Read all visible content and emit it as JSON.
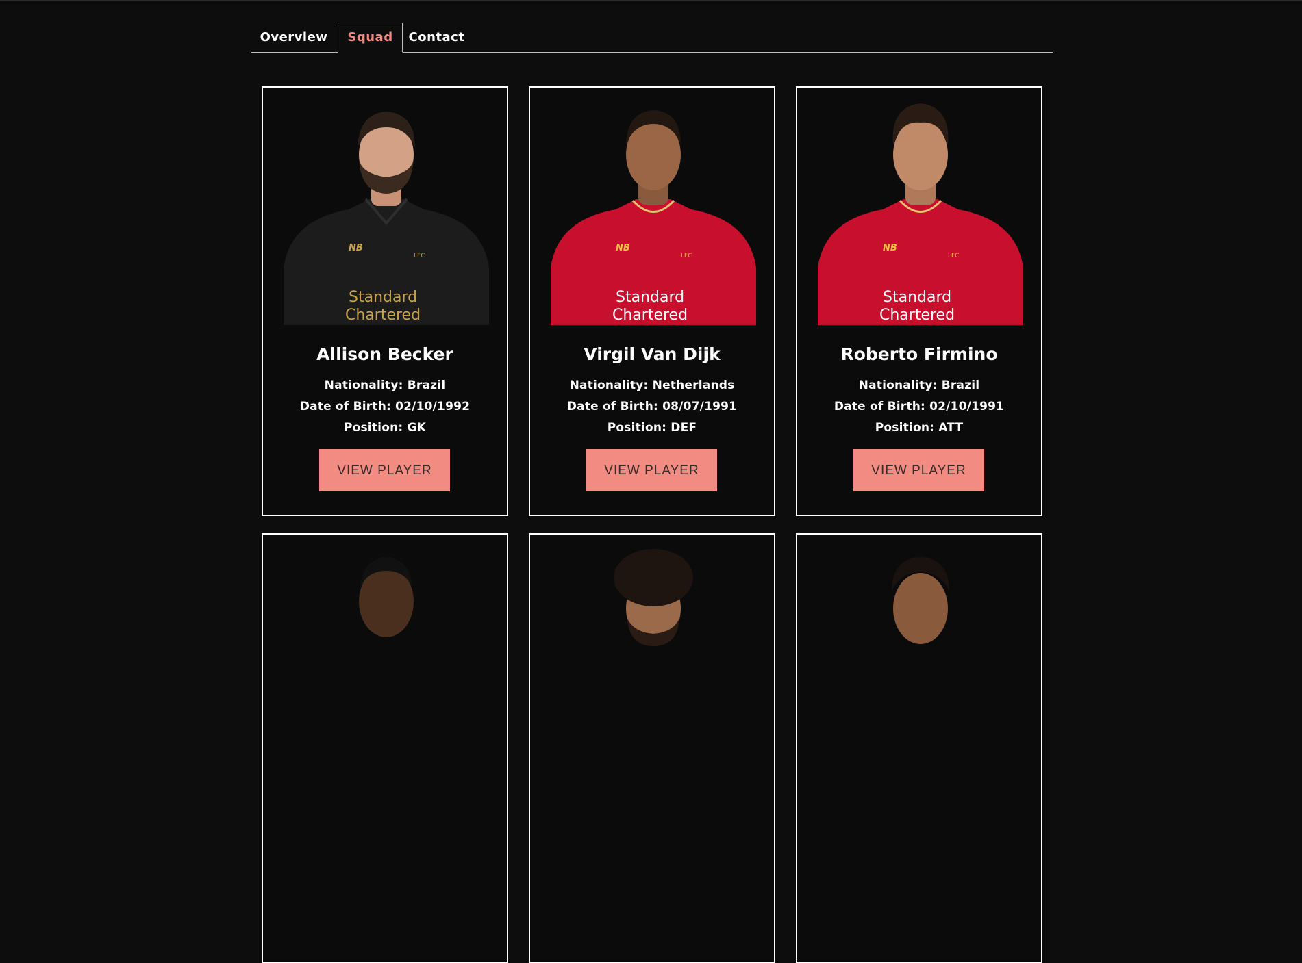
{
  "tabs": [
    {
      "label": "Overview",
      "active": false
    },
    {
      "label": "Squad",
      "active": true
    },
    {
      "label": "Contact",
      "active": false
    }
  ],
  "colors": {
    "background": "#0d0d0d",
    "accent": "#f28b82",
    "border": "#ffffff",
    "kit_home": "#c8102e",
    "kit_gk": "#1c1c1c"
  },
  "players": [
    {
      "name": "Allison Becker",
      "nationality": "Nationality: Brazil",
      "dob": "Date of Birth: 02/10/1992",
      "position": "Position: GK",
      "button": "VIEW PLAYER",
      "kit": "gk",
      "sponsor": [
        "Standard",
        "Chartered"
      ],
      "crest": "LFC"
    },
    {
      "name": "Virgil Van Dijk",
      "nationality": "Nationality: Netherlands",
      "dob": "Date of Birth: 08/07/1991",
      "position": "Position: DEF",
      "button": "VIEW PLAYER",
      "kit": "home",
      "sponsor": [
        "Standard",
        "Chartered"
      ],
      "crest": "LFC"
    },
    {
      "name": "Roberto Firmino",
      "nationality": "Nationality: Brazil",
      "dob": "Date of Birth: 02/10/1991",
      "position": "Position: ATT",
      "button": "VIEW PLAYER",
      "kit": "home",
      "sponsor": [
        "Standard",
        "Chartered"
      ],
      "crest": "LFC"
    },
    {
      "kit": "home"
    },
    {
      "kit": "home"
    },
    {
      "kit": "home"
    }
  ]
}
